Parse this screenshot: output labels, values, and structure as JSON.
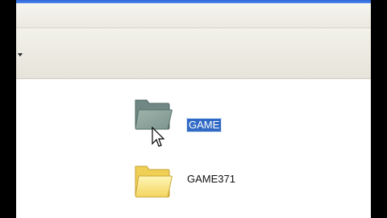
{
  "window": {
    "accent_color": "#316ac5",
    "icons": [
      "dropdown-arrow-icon"
    ]
  },
  "items": [
    {
      "label": "GAME",
      "icon": "folder-icon",
      "selected": true
    },
    {
      "label": "GAME371",
      "icon": "folder-icon",
      "selected": false
    }
  ],
  "cursor": {
    "icon": "pointer-cursor-icon"
  }
}
